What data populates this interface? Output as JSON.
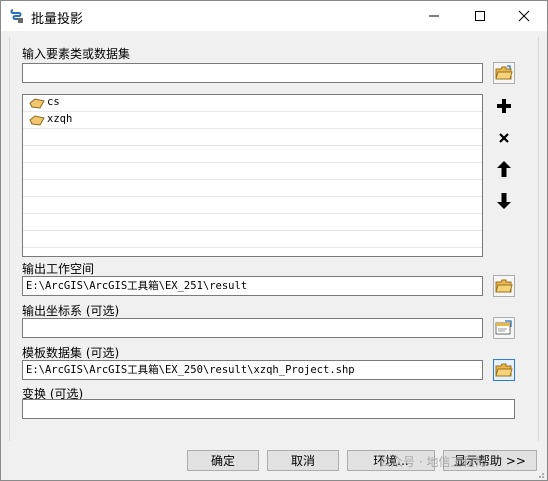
{
  "window": {
    "title": "批量投影"
  },
  "fields": {
    "input_label": "输入要素类或数据集",
    "input_value": "",
    "list_items": [
      {
        "label": "cs",
        "icon": "polygon-layer-icon"
      },
      {
        "label": "xzqh",
        "icon": "polygon-layer-icon"
      }
    ],
    "workspace_label": "输出工作空间",
    "workspace_value": "E:\\ArcGIS\\ArcGIS工具箱\\EX_251\\result",
    "coord_label": "输出坐标系 (可选)",
    "coord_value": "",
    "template_label": "模板数据集 (可选)",
    "template_value": "E:\\ArcGIS\\ArcGIS工具箱\\EX_250\\result\\xzqh_Project.shp",
    "transform_label": "变换 (可选)",
    "transform_value": ""
  },
  "buttons": {
    "ok": "确定",
    "cancel": "取消",
    "env": "环境...",
    "help": "显示帮助 >>"
  },
  "watermark": "公众号 · 地信工程师",
  "colors": {
    "accent": "#2f7bd6",
    "folder": "#e8b84a"
  }
}
